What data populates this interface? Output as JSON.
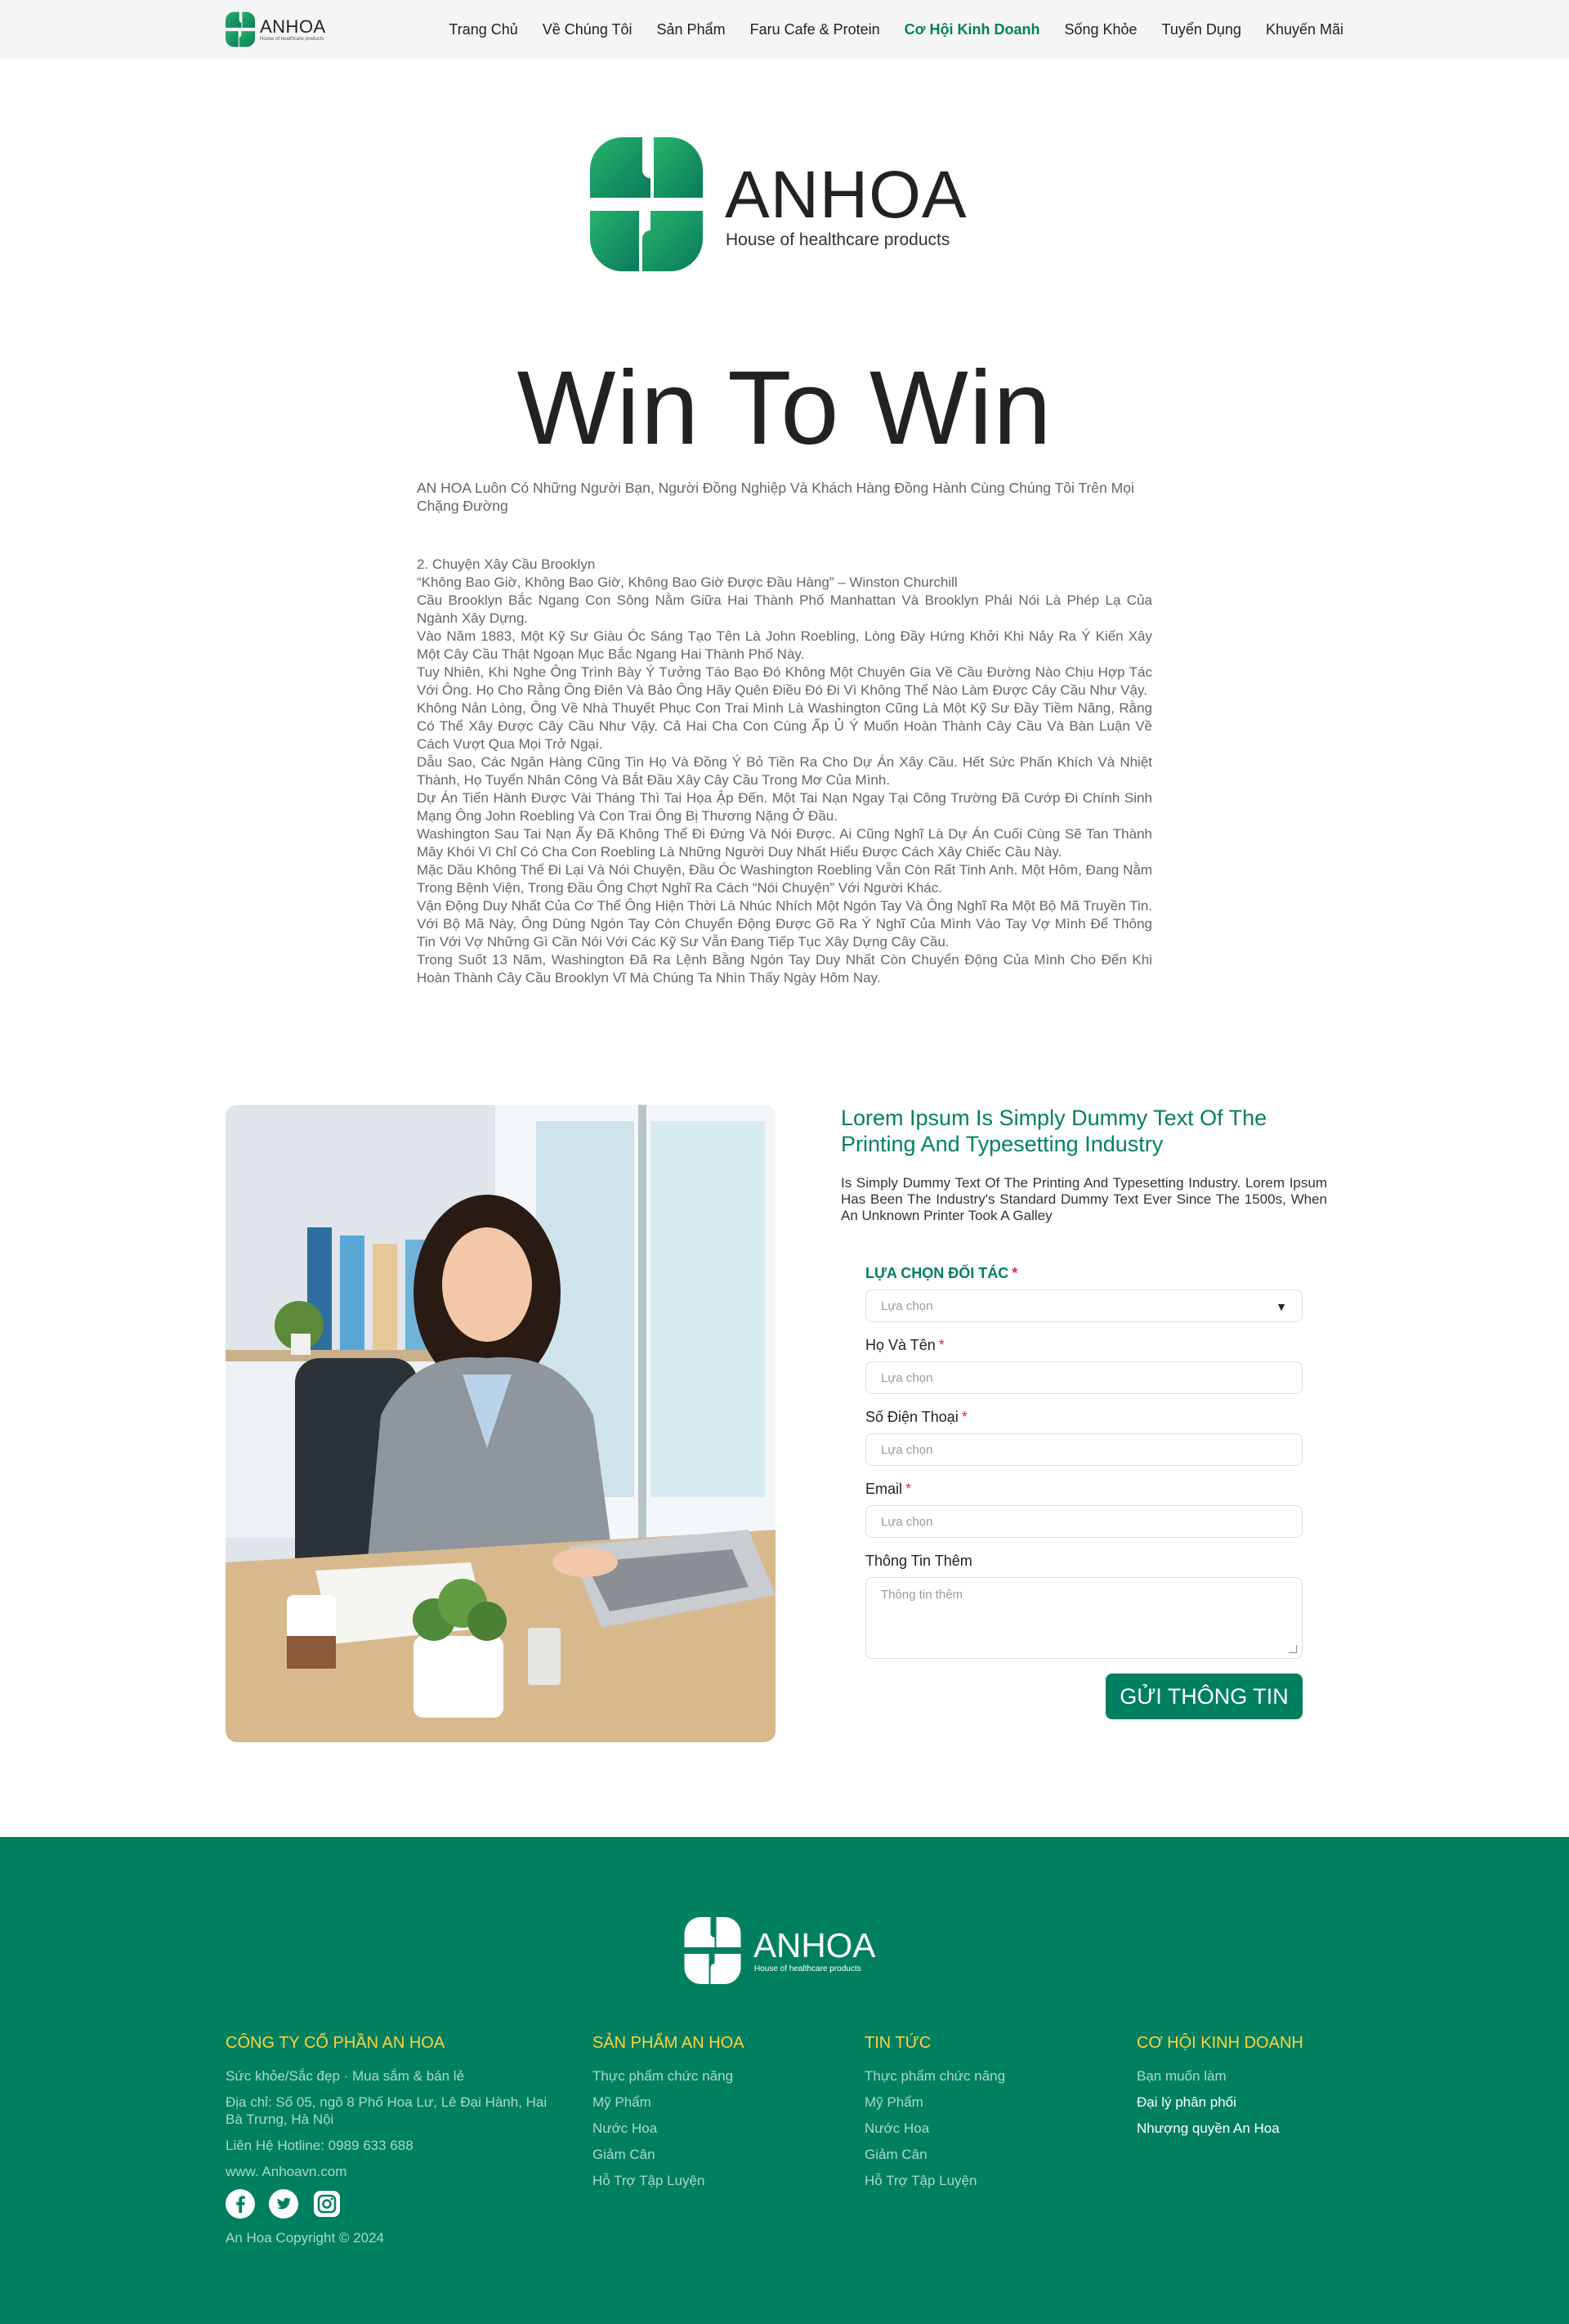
{
  "nav": {
    "brand": "ANHOA",
    "tagline": "House of healthcare products",
    "items": [
      {
        "label": "Trang Chủ"
      },
      {
        "label": "Về Chúng Tôi"
      },
      {
        "label": "Sản Phẩm"
      },
      {
        "label": "Faru Cafe & Protein"
      },
      {
        "label": "Cơ Hội Kinh Doanh",
        "active": true
      },
      {
        "label": "Sống Khỏe"
      },
      {
        "label": "Tuyển Dụng"
      },
      {
        "label": "Khuyến Mãi"
      }
    ]
  },
  "hero": {
    "brand": "ANHOA",
    "tagline": "House of healthcare products"
  },
  "page": {
    "title": "Win To Win",
    "intro": "AN HOA Luôn Có Những Người Bạn, Người Đồng Nghiệp Và Khách Hàng Đồng Hành Cùng Chúng Tôi Trên Mọi Chặng Đường",
    "article": [
      "2. Chuyện Xây Cầu Brooklyn",
      "“Không Bao Giờ, Không Bao Giờ, Không Bao Giờ Được Đầu Hàng” – Winston Churchill",
      "Cầu Brooklyn Bắc Ngang Con Sông Nằm Giữa Hai Thành Phố Manhattan Và Brooklyn Phải Nói Là Phép Lạ Của Ngành Xây Dựng.",
      "Vào Năm 1883, Một Kỹ Sư Giàu Óc Sáng Tạo Tên Là John Roebling, Lòng Đầy Hứng Khởi Khi Nảy Ra Ý Kiến Xây Một Cây Cầu Thật Ngoạn Mục Bắc Ngang Hai Thành Phố Này.",
      "Tuy Nhiên, Khi Nghe Ông Trình Bày Ý Tưởng Táo Bạo Đó Không Một Chuyên Gia Về Cầu Đường Nào Chịu Hợp Tác Với Ông. Họ Cho Rằng Ông Điên Và Bảo Ông Hãy Quên Điều Đó Đi Vì Không Thể Nào Làm Được Cây Cầu Như Vậy.",
      "Không Nản Lòng, Ông Về Nhà Thuyết Phục Con Trai Mình Là Washington Cũng Là Một Kỹ Sư Đầy Tiềm Năng, Rằng Có Thể Xây Được Cây Cầu Như Vậy. Cả Hai Cha Con Cùng Ấp Ủ Ý Muốn Hoàn Thành Cây Cầu Và Bàn Luận Về Cách Vượt Qua Mọi Trở Ngại.",
      "Dẫu Sao, Các Ngân Hàng Cũng Tin Họ Và Đồng Ý Bỏ Tiền Ra Cho Dự Án Xây Cầu. Hết Sức Phấn Khích Và Nhiệt Thành, Họ Tuyển Nhân Công Và Bắt Đầu Xây Cây Cầu Trong Mơ Của Mình.",
      "Dự Án Tiến Hành Được Vài Tháng Thì Tai Họa Ập Đến. Một Tai Nạn Ngay Tại Công Trường Đã Cướp Đi Chính Sinh Mạng Ông John Roebling Và Con Trai Ông Bị Thương Nặng Ở Đầu.",
      "Washington Sau Tai Nạn Ấy Đã Không Thể Đi Đứng Và Nói Được. Ai Cũng Nghĩ Là Dự Án Cuối Cùng Sẽ Tan Thành Mây Khói Vì Chỉ Có Cha Con Roebling Là Những Người Duy Nhất Hiểu Được Cách Xây Chiếc Cầu Này.",
      "Mặc Dầu Không Thể Đi Lại Và Nói Chuyện, Đầu Óc Washington Roebling Vẫn Còn Rất Tinh Anh. Một Hôm, Đang Nằm Trong Bệnh Viện, Trong Đầu Ông Chợt Nghĩ Ra Cách “Nói Chuyện” Với Người Khác.",
      "Vận Động Duy Nhất Của Cơ Thể Ông Hiện Thời Là Nhúc Nhích Một Ngón Tay Và Ông Nghĩ Ra Một Bộ Mã Truyền Tin. Với Bộ Mã Này, Ông Dùng Ngón Tay Còn Chuyển Động Được Gõ Ra Ý Nghĩ Của Mình Vào Tay Vợ Mình Để Thông Tin Với Vợ Những Gì Cần Nói Với Các Kỹ Sư Vẫn Đang Tiếp Tục Xây Dựng Cây Cầu.",
      "Trong Suốt 13 Năm, Washington Đã Ra Lệnh Bằng Ngón Tay Duy Nhất Còn Chuyển Động Của Mình Cho Đến Khi Hoàn Thành Cây Cầu Brooklyn Vĩ Mà Chúng Ta Nhìn Thấy Ngày Hôm Nay."
    ]
  },
  "form_section": {
    "heading": "Lorem Ipsum Is Simply Dummy Text Of The Printing And Typesetting Industry",
    "description": "Is Simply Dummy Text Of The Printing And Typesetting Industry. Lorem Ipsum Has Been The Industry's Standard Dummy Text Ever Since The 1500s, When An Unknown Printer Took A Galley",
    "required_mark": "*",
    "partner_label": "LỰA CHỌN ĐỐI TÁC",
    "partner_placeholder": "Lựa chọn",
    "name_label": "Họ Và Tên",
    "name_placeholder": "Lựa chọn",
    "phone_label": "Số Điện Thoại",
    "phone_placeholder": "Lựa chọn",
    "email_label": "Email",
    "email_placeholder": "Lựa chọn",
    "extra_label": "Thông Tin Thêm",
    "extra_placeholder": "Thông tin thêm",
    "submit_label": "GỬI THÔNG TIN"
  },
  "footer": {
    "brand": "ANHOA",
    "tagline": "House of healthcare products",
    "company": {
      "heading": "CÔNG TY CỔ PHẦN AN HOA",
      "slogan": "Sức khỏe/Sắc đẹp · Mua sắm & bán lẻ",
      "address": "Địa chỉ: Số 05, ngõ 8 Phố Hoa Lư, Lê Đại Hành, Hai Bà Trưng, Hà Nội",
      "hotline": "Liên Hệ Hotline: 0989 633 688",
      "website": "www. Anhoavn.com",
      "copyright": "An Hoa Copyright © 2024"
    },
    "products": {
      "heading": "SẢN PHẨM AN HOA",
      "items": [
        "Thực phẩm chức năng",
        "Mỹ Phẩm",
        "Nước Hoa",
        "Giảm Cân",
        "Hỗ Trợ Tập Luyện"
      ]
    },
    "news": {
      "heading": "TIN TỨC",
      "items": [
        "Thực phẩm chức năng",
        "Mỹ Phẩm",
        "Nước Hoa",
        "Giảm Cân",
        "Hỗ Trợ Tập Luyện"
      ]
    },
    "business": {
      "heading": "CƠ HỘI KINH DOANH",
      "items": [
        "Bạn muốn làm",
        "Đại lý phân phối",
        "Nhượng quyền An Hoa"
      ]
    },
    "socials": [
      "facebook-icon",
      "twitter-icon",
      "instagram-icon"
    ]
  },
  "colors": {
    "brand_green": "#008060",
    "footer_heading": "#ffd23f",
    "required": "#e0245e"
  }
}
